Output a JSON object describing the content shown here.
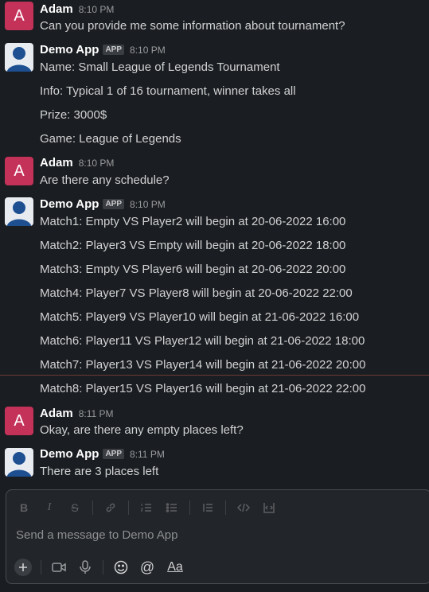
{
  "messages": [
    {
      "sender": "Adam",
      "avatar_letter": "A",
      "time": "8:10 PM",
      "lines": [
        "Can you provide me some information about tournament?"
      ]
    },
    {
      "sender": "Demo App",
      "app_tag": "APP",
      "time": "8:10 PM",
      "lines": [
        "Name: Small League of Legends Tournament",
        "Info: Typical 1 of 16 tournament, winner takes all",
        "Prize: 3000$",
        "Game: League of Legends"
      ]
    },
    {
      "sender": "Adam",
      "avatar_letter": "A",
      "time": "8:10 PM",
      "lines": [
        "Are there any schedule?"
      ]
    },
    {
      "sender": "Demo App",
      "app_tag": "APP",
      "time": "8:10 PM",
      "lines": [
        "Match1: Empty VS Player2 will begin at 20-06-2022 16:00",
        "Match2: Player3 VS Empty will begin at 20-06-2022 18:00",
        "Match3: Empty VS Player6 will begin at 20-06-2022 20:00",
        "Match4: Player7 VS Player8 will begin at 20-06-2022 22:00",
        "Match5: Player9 VS Player10 will begin at 21-06-2022 16:00",
        "Match6: Player11 VS Player12 will begin at 21-06-2022 18:00",
        "Match7: Player13 VS Player14 will begin at 21-06-2022 20:00",
        "Match8: Player15 VS Player16 will begin at 21-06-2022 22:00"
      ]
    },
    {
      "sender": "Adam",
      "avatar_letter": "A",
      "time": "8:11 PM",
      "lines": [
        "Okay, are there any empty places left?"
      ]
    },
    {
      "sender": "Demo App",
      "app_tag": "APP",
      "time": "8:11 PM",
      "lines": [
        "There are 3 places left"
      ]
    }
  ],
  "composer": {
    "placeholder": "Send a message to Demo App",
    "format_icons": [
      "bold-icon",
      "italic-icon",
      "strikethrough-icon",
      "link-icon",
      "ordered-list-icon",
      "bulleted-list-icon",
      "blockquote-icon",
      "code-icon",
      "code-block-icon"
    ],
    "format_glyphs": {
      "bold": "B",
      "italic": "I",
      "strike": "S",
      "format": "Aa"
    },
    "action_icons": [
      "plus-icon",
      "video-icon",
      "microphone-icon",
      "emoji-icon",
      "mention-icon",
      "format-icon"
    ]
  },
  "colors": {
    "background": "#1a1d21",
    "avatar_adam": "#c4325a",
    "text": "#d1d2d3",
    "divider": "#6b3a36"
  }
}
